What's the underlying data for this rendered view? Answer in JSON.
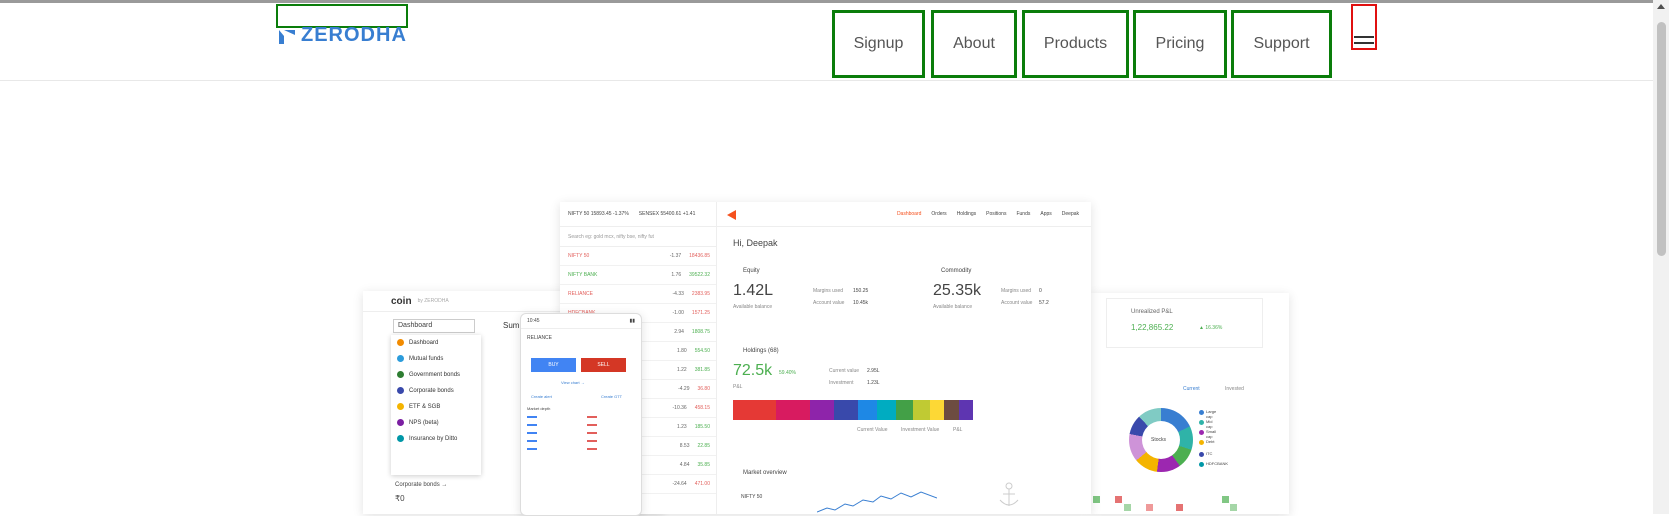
{
  "brand": {
    "name": "ZERODHA",
    "color": "#387ed1"
  },
  "nav": {
    "signup": "Signup",
    "about": "About",
    "products": "Products",
    "pricing": "Pricing",
    "support": "Support",
    "menu_icon": "hamburger-menu-icon"
  },
  "hero": {
    "coin": {
      "logo": "coin",
      "by": "by ZERODHA",
      "dropdown": "Dashboard",
      "summary": "Summ",
      "menu": [
        "Dashboard",
        "Mutual funds",
        "Government bonds",
        "Corporate bonds",
        "ETF & SGB",
        "NPS (beta)",
        "Insurance by Ditto"
      ],
      "footer_label": "Corporate bonds →",
      "footer_value": "₹0"
    },
    "kite": {
      "ticker_nifty": "NIFTY 50  15893.45  -1.37%",
      "ticker_sensex": "SENSEX  55400.61  +1.41",
      "search_placeholder": "Search eg: gold mcx, nifty bse, nifty fut",
      "watchlist": [
        {
          "name": "NIFTY 50",
          "chg": "-1.37",
          "price": "18436.85",
          "dir": "down"
        },
        {
          "name": "NIFTY BANK",
          "chg": "1.76",
          "price": "39522.32",
          "dir": "up"
        },
        {
          "name": "RELIANCE",
          "chg": "-4.33",
          "price": "2383.95",
          "dir": "down"
        },
        {
          "name": "HDFCBANK",
          "chg": "-1.00",
          "price": "1571.25",
          "dir": "down"
        },
        {
          "name": "",
          "chg": "2.94",
          "price": "1808.75",
          "dir": "up"
        },
        {
          "name": "",
          "chg": "1.80",
          "price": "554.50",
          "dir": "up"
        },
        {
          "name": "",
          "chg": "1.22",
          "price": "381.85",
          "dir": "up"
        },
        {
          "name": "",
          "chg": "-4.29",
          "price": "36.80",
          "dir": "down"
        },
        {
          "name": "",
          "chg": "-10.36",
          "price": "458.15",
          "dir": "down"
        },
        {
          "name": "",
          "chg": "1.23",
          "price": "185.50",
          "dir": "up"
        },
        {
          "name": "",
          "chg": "8.53",
          "price": "22.85",
          "dir": "up"
        },
        {
          "name": "",
          "chg": "4.84",
          "price": "35.85",
          "dir": "up"
        },
        {
          "name": "",
          "chg": "-24.64",
          "price": "471.00",
          "dir": "down"
        }
      ],
      "nav": [
        "Dashboard",
        "Orders",
        "Holdings",
        "Positions",
        "Funds",
        "Apps",
        "Deepak"
      ],
      "greeting": "Hi, Deepak",
      "equity_label": "Equity",
      "equity_value": "1.42L",
      "equity_sub": "Available balance",
      "margins_used_label": "Margins used",
      "equity_margins_used": "150.25",
      "opening_balance_label": "Account value",
      "equity_account_value": "10.45k",
      "commodity_label": "Commodity",
      "commodity_value": "25.35k",
      "commodity_sub": "Available balance",
      "commodity_margins_used": "0",
      "commodity_account_value": "57.2",
      "holdings_label": "Holdings (68)",
      "holdings_value": "72.5k",
      "holdings_pct": "59.40%",
      "holdings_sub": "P&L",
      "current_value_label": "Current value",
      "current_value": "2.95L",
      "investment_label": "Investment",
      "investment_value": "1.23L",
      "legend": [
        "Current Value",
        "Investment Value",
        "P&L"
      ],
      "market_overview": "Market overview",
      "nifty_label": "NIFTY 50"
    },
    "mobile": {
      "time": "10:45",
      "symbol": "RELIANCE",
      "buy": "BUY",
      "sell": "SELL",
      "view_chart": "View chart →",
      "create_alert": "Create alert",
      "create_gtt": "Create GTT",
      "market_depth": "Market depth"
    },
    "console": {
      "unrealized_label": "Unrealized P&L",
      "unrealized_value": "1,22,865.22",
      "unrealized_pct": "▲ 16.36%",
      "toggle_current": "Current",
      "toggle_invested": "Invested",
      "donut_center": "Stocks",
      "legend": [
        "Large cap",
        "Mid cap",
        "Small cap",
        "Debt",
        "ITC",
        "HDFCBANK"
      ]
    }
  },
  "colors": {
    "up": "#4caf50",
    "down": "#e25f5b",
    "buy": "#4184f3",
    "sell": "#d43725",
    "accent": "#f5511e"
  }
}
